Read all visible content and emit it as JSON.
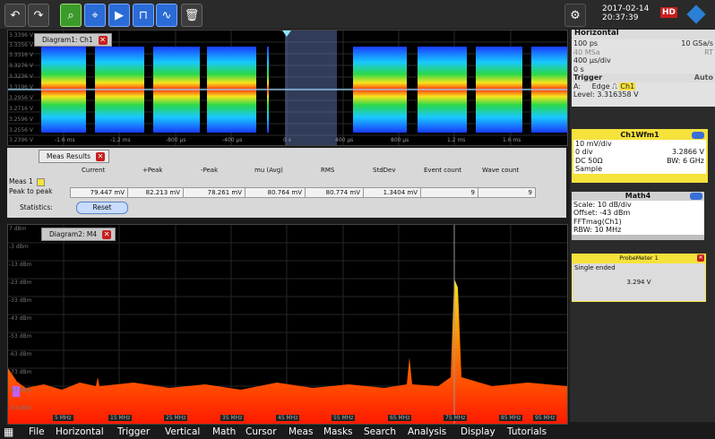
{
  "toolbar": {
    "buttons": [
      "undo-icon",
      "redo-icon",
      "zoom-icon",
      "measure-icon",
      "marker-icon",
      "mask-icon",
      "fft-icon",
      "trash-icon"
    ],
    "date": "2017-02-14",
    "time": "20:37:39",
    "hd_badge": "HD"
  },
  "diagram1": {
    "tab_label": "Diagram1: Ch1",
    "y_labels": [
      "3.3396 V",
      "3.3356 V",
      "3.3316 V",
      "3.3276 V",
      "3.3236 V",
      "3.3196 V",
      "3.2956 V",
      "3.2716 V",
      "3.2596 V",
      "3.2556 V",
      "3.2396 V"
    ],
    "x_labels": [
      "-1.6 ms",
      "-1.2 ms",
      "-800 µs",
      "-400 µs",
      "0 s",
      "400 µs",
      "800 µs",
      "1.2 ms",
      "1.6 ms"
    ]
  },
  "meas": {
    "tab_label": "Meas Results",
    "headers": [
      "Current",
      "+Peak",
      "-Peak",
      "mu (Avg)",
      "RMS",
      "StdDev",
      "Event count",
      "Wave count"
    ],
    "meas_label": "Meas 1",
    "row_label": "Peak to peak",
    "values": [
      "79.447 mV",
      "82.213 mV",
      "78.261 mV",
      "80.764 mV",
      "80.774 mV",
      "1.3404 mV",
      "9",
      "9"
    ],
    "statistics_label": "Statistics:",
    "reset_label": "Reset"
  },
  "diagram2": {
    "tab_label": "Diagram2: M4",
    "y_labels": [
      "7 dBm",
      "-3 dBm",
      "-13 dBm",
      "-23 dBm",
      "-33 dBm",
      "-43 dBm",
      "-53 dBm",
      "-63 dBm",
      "-73 dBm",
      "-83 dBm",
      "-93 dBm"
    ],
    "x_labels": [
      "5 MHz",
      "15 MHz",
      "25 MHz",
      "35 MHz",
      "45 MHz",
      "55 MHz",
      "65 MHz",
      "75 MHz",
      "85 MHz",
      "95 MHz"
    ]
  },
  "horizontal": {
    "title": "Horizontal",
    "row1_left": "100 ps",
    "row1_right": "10 GSa/s",
    "row2_left": "40 MSa",
    "row2_right": "RT",
    "row3": "400 µs/div",
    "row4": "0 s"
  },
  "trigger": {
    "title": "Trigger",
    "mode": "Auto",
    "source_prefix": "A:",
    "type": "Edge",
    "channel": "Ch1",
    "level": "Level: 3.316358 V"
  },
  "ch1wfm": {
    "title": "Ch1Wfm1",
    "scale": "10 mV/div",
    "offset_left": "0 div",
    "offset_right": "3.2866 V",
    "coupling": "DC 50Ω",
    "bw": "BW: 6 GHz",
    "mode": "Sample"
  },
  "math4": {
    "title": "Math4",
    "scale": "Scale:  10 dB/div",
    "offset": "Offset: -43 dBm",
    "expr": "FFTmag(Ch1)",
    "rbw": "RBW:  10 MHz"
  },
  "probemeter": {
    "title": "ProbeMeter 1",
    "mode": "Single ended",
    "value": "3.294 V"
  },
  "menu": [
    "File",
    "Horizontal",
    "Trigger",
    "Vertical",
    "Math",
    "Cursor",
    "Meas",
    "Masks",
    "Search",
    "Analysis",
    "Display",
    "Tutorials"
  ],
  "colors": {
    "accent": "#2a6bd6",
    "ch1": "#f5e23b",
    "alert": "#c81e1e"
  }
}
